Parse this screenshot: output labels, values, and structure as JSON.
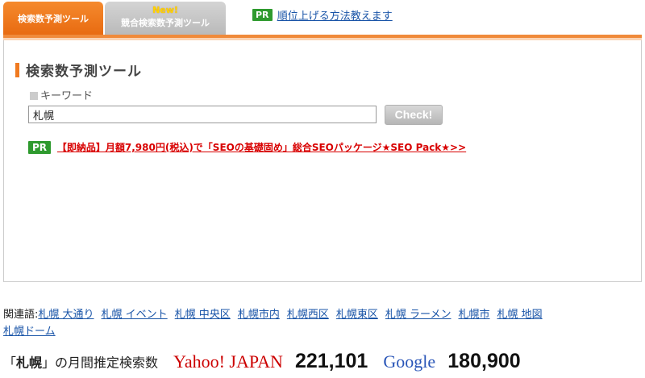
{
  "tabs": {
    "active_label": "検索数予測ツール",
    "inactive_new": "New!",
    "inactive_label": "競合検索数予測ツール"
  },
  "top_pr": {
    "badge": "PR",
    "link": "順位上げる方法教えます"
  },
  "tool": {
    "heading": "検索数予測ツール",
    "keyword_label": "キーワード",
    "keyword_value": "札幌",
    "check_button": "Check!"
  },
  "main_pr": {
    "badge": "PR",
    "link": "【即納品】月額7,980円(税込)で「SEOの基礎固め」総合SEOパッケージ★SEO Pack★>>"
  },
  "related": {
    "label": "関連語:",
    "items": [
      "札幌 大通り",
      "札幌 イベント",
      "札幌 中央区",
      "札幌市内",
      "札幌西区",
      "札幌東区",
      "札幌 ラーメン",
      "札幌市",
      "札幌 地図",
      "札幌ドーム"
    ]
  },
  "counts": {
    "prefix_open": "「",
    "keyword": "札幌",
    "prefix_close": "」の月間推定検索数",
    "yahoo_label": "Yahoo! JAPAN",
    "yahoo_value": "221,101",
    "google_label": "Google",
    "google_value": "180,900"
  },
  "colors": {
    "accent": "#f07a20",
    "pr_green": "#2e9a2e",
    "link_blue": "#1a55a8",
    "pr_red": "#d80000"
  }
}
